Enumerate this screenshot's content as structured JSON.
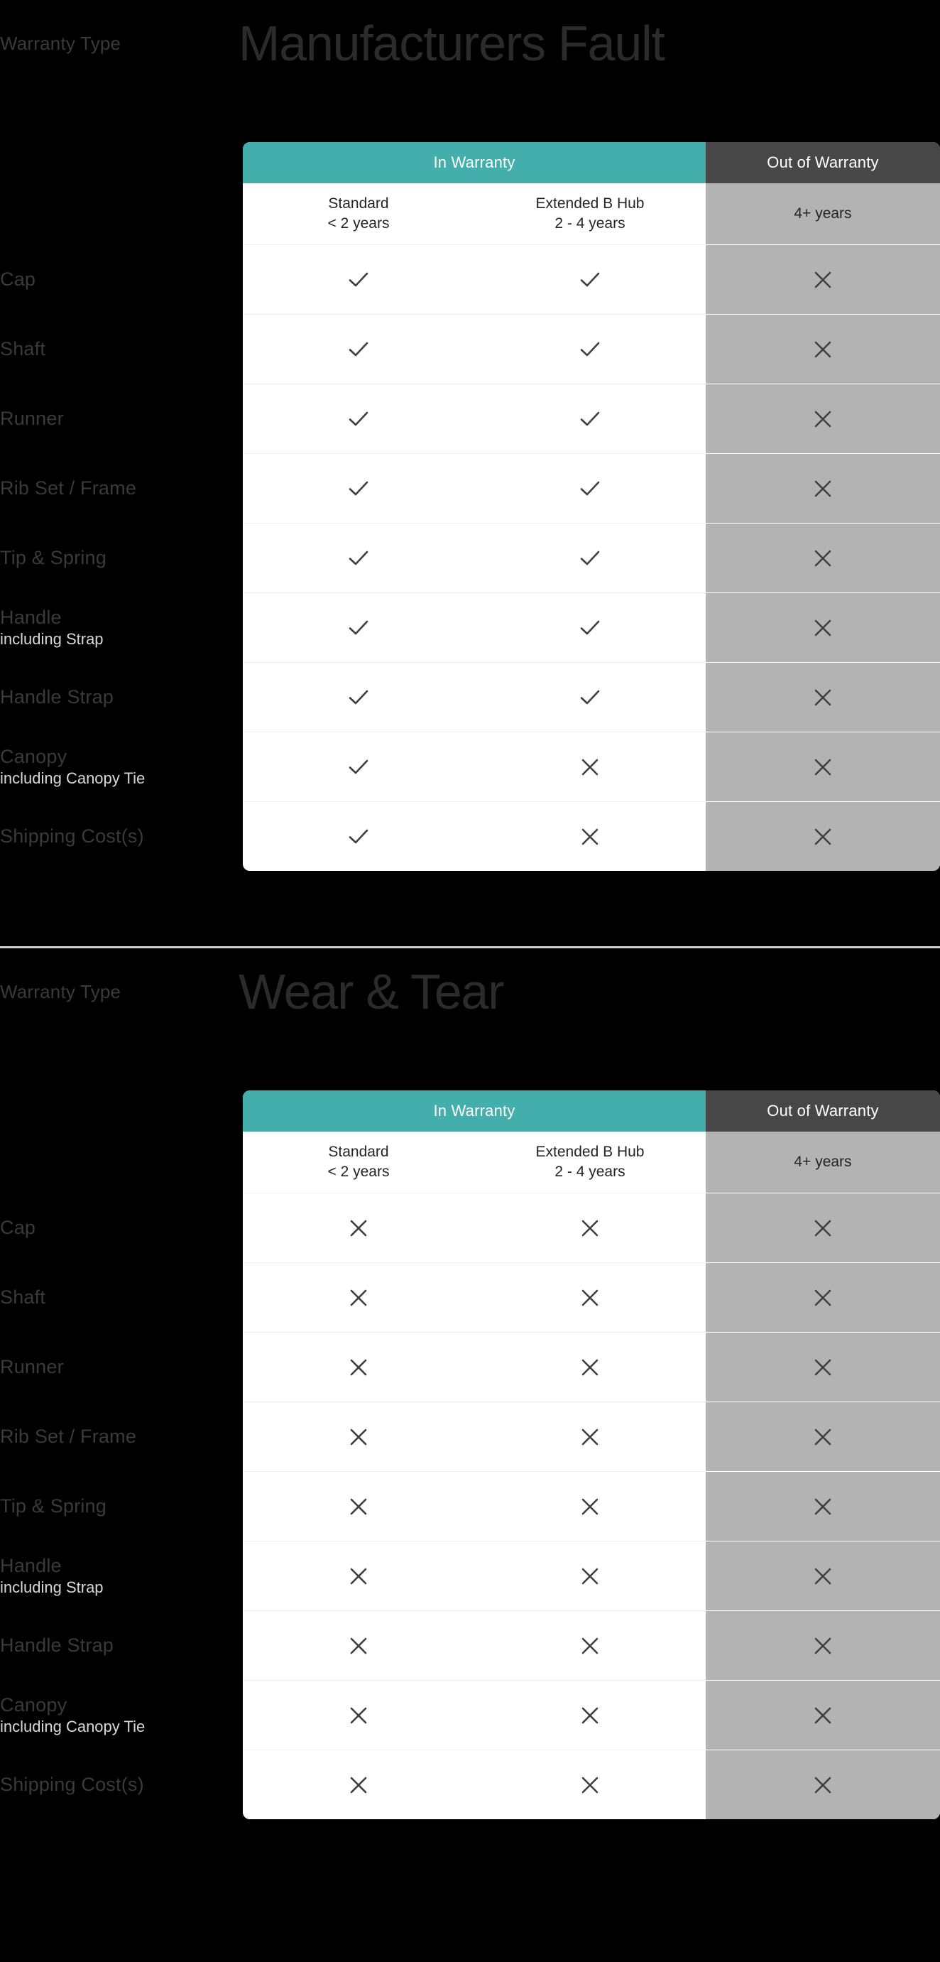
{
  "page": {
    "background": "#000000",
    "accent_teal": "#44aeac",
    "out_gray": "#b3b3b3",
    "out_header_gray": "#474747"
  },
  "columns": {
    "group_in_warranty": "In Warranty",
    "group_out_of_warranty": "Out of Warranty",
    "standard_name": "Standard",
    "standard_range": "< 2 years",
    "extended_name": "Extended B Hub",
    "extended_range": "2 - 4 years",
    "out_range": "4+ years"
  },
  "sections": [
    {
      "eyebrow": "Warranty Type",
      "title": "Manufacturers Fault",
      "rows": [
        {
          "label": "Cap",
          "sub": "",
          "standard": "check",
          "extended": "check",
          "out": "cross"
        },
        {
          "label": "Shaft",
          "sub": "",
          "standard": "check",
          "extended": "check",
          "out": "cross"
        },
        {
          "label": "Runner",
          "sub": "",
          "standard": "check",
          "extended": "check",
          "out": "cross"
        },
        {
          "label": "Rib Set / Frame",
          "sub": "",
          "standard": "check",
          "extended": "check",
          "out": "cross"
        },
        {
          "label": "Tip & Spring",
          "sub": "",
          "standard": "check",
          "extended": "check",
          "out": "cross"
        },
        {
          "label": "Handle",
          "sub": "including Strap",
          "standard": "check",
          "extended": "check",
          "out": "cross"
        },
        {
          "label": "Handle Strap",
          "sub": "",
          "standard": "check",
          "extended": "check",
          "out": "cross"
        },
        {
          "label": "Canopy",
          "sub": "including Canopy Tie",
          "standard": "check",
          "extended": "cross",
          "out": "cross"
        },
        {
          "label": "Shipping Cost(s)",
          "sub": "",
          "standard": "check",
          "extended": "cross",
          "out": "cross"
        }
      ]
    },
    {
      "eyebrow": "Warranty Type",
      "title": "Wear & Tear",
      "rows": [
        {
          "label": "Cap",
          "sub": "",
          "standard": "cross",
          "extended": "cross",
          "out": "cross"
        },
        {
          "label": "Shaft",
          "sub": "",
          "standard": "cross",
          "extended": "cross",
          "out": "cross"
        },
        {
          "label": "Runner",
          "sub": "",
          "standard": "cross",
          "extended": "cross",
          "out": "cross"
        },
        {
          "label": "Rib Set / Frame",
          "sub": "",
          "standard": "cross",
          "extended": "cross",
          "out": "cross"
        },
        {
          "label": "Tip & Spring",
          "sub": "",
          "standard": "cross",
          "extended": "cross",
          "out": "cross"
        },
        {
          "label": "Handle",
          "sub": "including Strap",
          "standard": "cross",
          "extended": "cross",
          "out": "cross"
        },
        {
          "label": "Handle Strap",
          "sub": "",
          "standard": "cross",
          "extended": "cross",
          "out": "cross"
        },
        {
          "label": "Canopy",
          "sub": "including Canopy Tie",
          "standard": "cross",
          "extended": "cross",
          "out": "cross"
        },
        {
          "label": "Shipping Cost(s)",
          "sub": "",
          "standard": "cross",
          "extended": "cross",
          "out": "cross"
        }
      ]
    }
  ],
  "icons": {
    "check": "check-icon",
    "cross": "cross-icon"
  }
}
